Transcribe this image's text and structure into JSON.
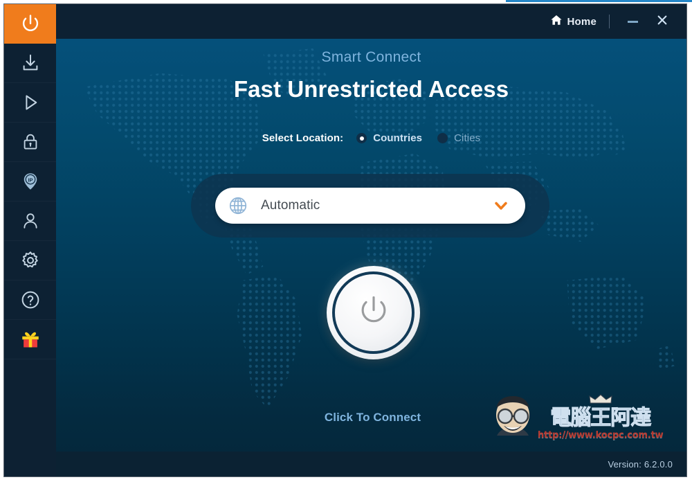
{
  "window": {
    "titlebar": {
      "home_label": "Home",
      "home_icon": "house-icon",
      "minimize_icon": "minimize-icon",
      "close_icon": "close-icon",
      "close_glyph": "✕"
    },
    "footer": {
      "version_text": "Version: 6.2.0.0"
    }
  },
  "sidebar": {
    "items": [
      {
        "id": "power",
        "icon": "power-icon",
        "active": true
      },
      {
        "id": "download",
        "icon": "download-icon",
        "active": false
      },
      {
        "id": "play",
        "icon": "play-icon",
        "active": false
      },
      {
        "id": "lock",
        "icon": "lock-icon",
        "active": false
      },
      {
        "id": "ip",
        "icon": "ip-pin-icon",
        "active": false
      },
      {
        "id": "account",
        "icon": "user-icon",
        "active": false
      },
      {
        "id": "settings",
        "icon": "gear-icon",
        "active": false
      },
      {
        "id": "help",
        "icon": "question-mark-icon",
        "active": false
      },
      {
        "id": "gift",
        "icon": "gift-icon",
        "active": false
      }
    ]
  },
  "main": {
    "subtitle": "Smart Connect",
    "headline": "Fast Unrestricted Access",
    "select_location": {
      "label": "Select Location:",
      "options": [
        {
          "label": "Countries",
          "selected": true
        },
        {
          "label": "Cities",
          "selected": false
        }
      ]
    },
    "location_dropdown": {
      "icon": "globe-icon",
      "value": "Automatic",
      "chevron_icon": "chevron-down-icon",
      "options": [
        "Automatic"
      ]
    },
    "connect_button": {
      "icon": "power-icon",
      "caption": "Click To Connect",
      "state": "disconnected"
    }
  },
  "watermark": {
    "brand_cn": "電腦王阿達",
    "url": "http://www.kocpc.com.tw",
    "face_icon": "cartoon-face-icon",
    "crown_icon": "crown-icon"
  },
  "colors": {
    "accent_orange": "#f07c1c",
    "sidebar_bg": "#0d2133",
    "panel_top": "#075177",
    "panel_bottom": "#05273a",
    "text_light_blue": "#7fb4de",
    "chevron_orange": "#f07c1c",
    "top_accent": "#2486c8"
  }
}
